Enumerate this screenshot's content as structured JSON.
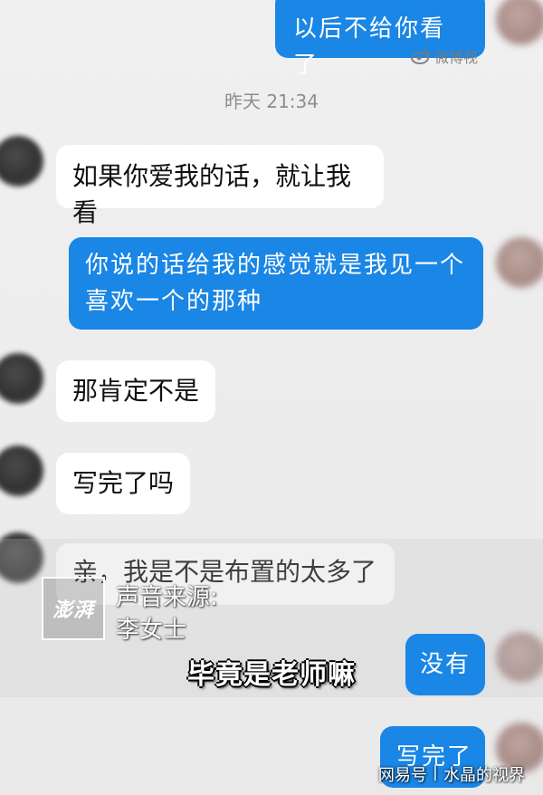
{
  "chat": {
    "timestamp": "昨天 21:34",
    "messages": [
      {
        "direction": "out",
        "text": "以后不给你看了"
      },
      {
        "direction": "in",
        "text": "如果你爱我的话，就让我看"
      },
      {
        "direction": "out",
        "text": "你说的话给我的感觉就是我见一个\n喜欢一个的那种"
      },
      {
        "direction": "in",
        "text": "那肯定不是"
      },
      {
        "direction": "in",
        "text": "写完了吗"
      },
      {
        "direction": "in",
        "text": "亲，我是不是布置的太多了"
      },
      {
        "direction": "out",
        "text": "没有"
      },
      {
        "direction": "out",
        "text": "写完了"
      }
    ]
  },
  "overlay": {
    "weibo_watermark": "微博视",
    "source_logo": "澎湃",
    "source_label": "声音来源:",
    "source_name": "李女士",
    "subtitle": "毕竟是老师嘛",
    "platform": "网易号",
    "author": "水晶的视界"
  },
  "colors": {
    "outgoing_bubble": "#1a86e5",
    "incoming_bubble": "#ffffff",
    "background": "#ededed"
  }
}
